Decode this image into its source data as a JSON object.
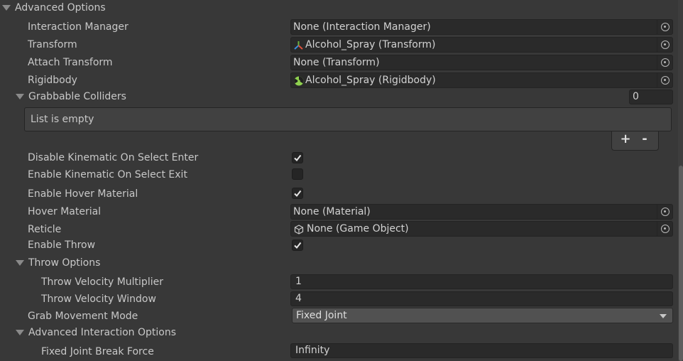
{
  "section": {
    "title": "Advanced Options"
  },
  "fields": {
    "interaction_manager": {
      "label": "Interaction Manager",
      "value": "None (Interaction Manager)"
    },
    "transform": {
      "label": "Transform",
      "value": "Alcohol_Spray (Transform)"
    },
    "attach_transform": {
      "label": "Attach Transform",
      "value": "None (Transform)"
    },
    "rigidbody": {
      "label": "Rigidbody",
      "value": "Alcohol_Spray (Rigidbody)"
    }
  },
  "grabbable_colliders": {
    "label": "Grabbable Colliders",
    "count": "0",
    "empty_text": "List is empty",
    "add_label": "+",
    "remove_label": "-"
  },
  "toggles": {
    "disable_kinematic_select_enter": {
      "label": "Disable Kinematic On Select Enter",
      "checked": true
    },
    "enable_kinematic_select_exit": {
      "label": "Enable Kinematic On Select Exit",
      "checked": false
    },
    "enable_hover_material": {
      "label": "Enable Hover Material",
      "checked": true
    }
  },
  "hover_material": {
    "label": "Hover Material",
    "value": "None (Material)"
  },
  "reticle": {
    "label": "Reticle",
    "value": "None (Game Object)"
  },
  "enable_throw": {
    "label": "Enable Throw",
    "checked": true
  },
  "throw_options": {
    "title": "Throw Options",
    "velocity_multiplier": {
      "label": "Throw Velocity Multiplier",
      "value": "1"
    },
    "velocity_window": {
      "label": "Throw Velocity Window",
      "value": "4"
    }
  },
  "grab_movement_mode": {
    "label": "Grab Movement Mode",
    "value": "Fixed Joint"
  },
  "advanced_interaction": {
    "title": "Advanced Interaction Options",
    "fixed_joint_break_force": {
      "label": "Fixed Joint Break Force",
      "value": "Infinity"
    }
  },
  "icons": {
    "picker": "object-picker-icon",
    "transform": "transform-icon",
    "rigidbody": "rigidbody-icon",
    "gameobject": "gameobject-cube-icon",
    "checkmark": "checkmark-icon"
  }
}
